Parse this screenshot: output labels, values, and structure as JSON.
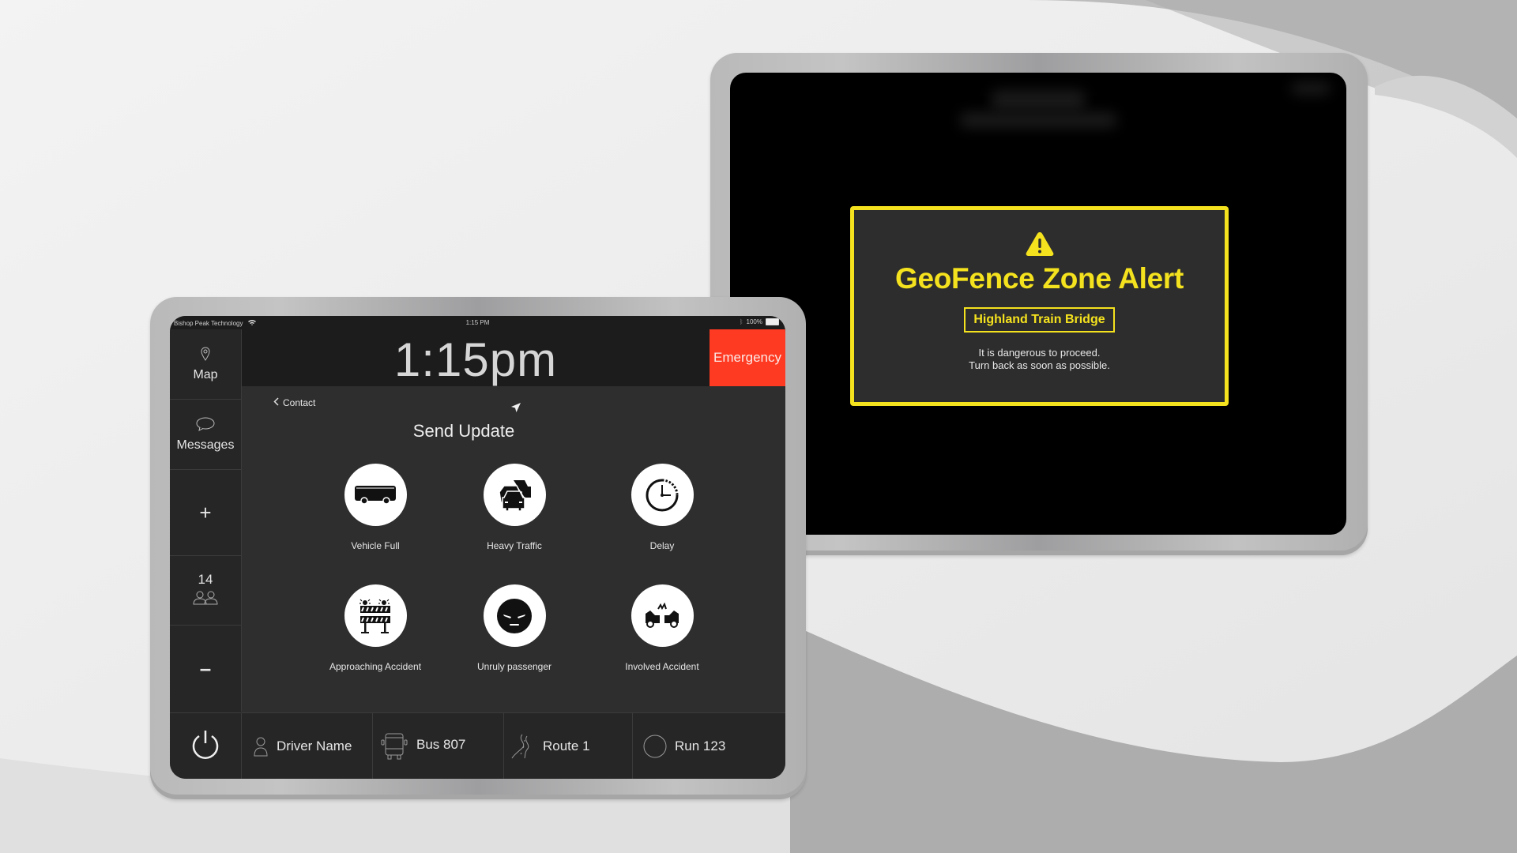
{
  "left_tablet": {
    "status_bar": {
      "carrier": "Bishop Peak Technology",
      "time": "1:15 PM",
      "battery": "100%"
    },
    "header": {
      "time": "1:15pm",
      "emergency_label": "Emergency",
      "emergency_color": "#ff3a22"
    },
    "sidebar": {
      "map_label": "Map",
      "messages_label": "Messages",
      "increment_label": "+",
      "passenger_count": "14",
      "decrement_label": "–"
    },
    "main": {
      "back_label": "Contact",
      "title": "Send Update",
      "actions": [
        {
          "label": "Vehicle Full",
          "icon": "bus-icon"
        },
        {
          "label": "Heavy Traffic",
          "icon": "traffic-icon"
        },
        {
          "label": "Delay",
          "icon": "clock-icon"
        },
        {
          "label": "Approaching Accident",
          "icon": "barricade-icon"
        },
        {
          "label": "Unruly passenger",
          "icon": "angry-face-icon"
        },
        {
          "label": "Involved Accident",
          "icon": "car-crash-icon"
        }
      ]
    },
    "footer": {
      "driver": "Driver Name",
      "bus": "Bus 807",
      "route": "Route 1",
      "run": "Run 123"
    }
  },
  "right_tablet": {
    "alert": {
      "title": "GeoFence Zone Alert",
      "zone": "Highland Train Bridge",
      "message_line1": "It is dangerous to proceed.",
      "message_line2": "Turn back as soon as possible.",
      "accent_color": "#f5e21e"
    }
  }
}
